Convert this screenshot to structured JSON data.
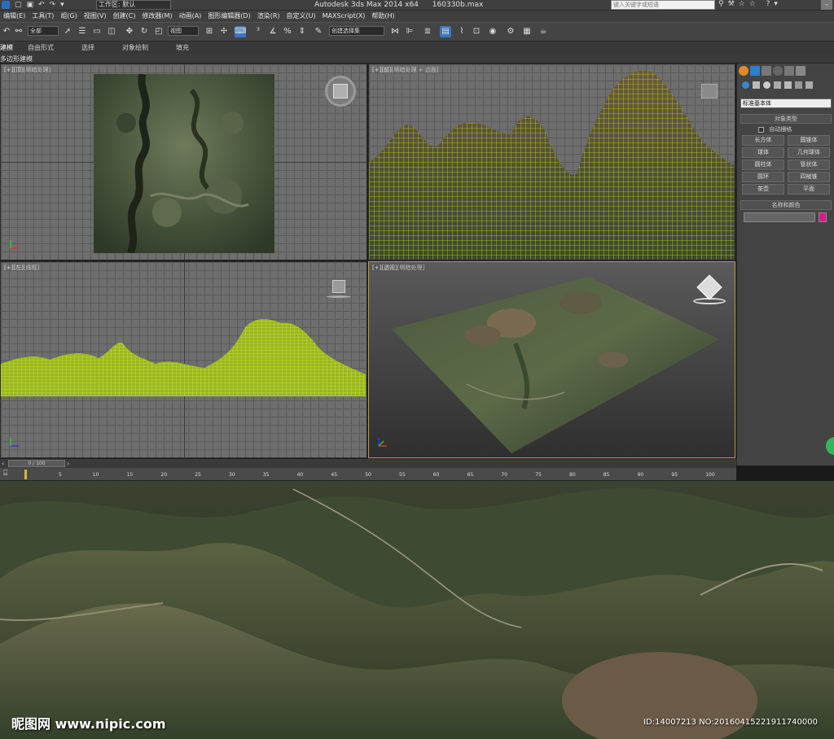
{
  "title": {
    "workspace_label": "工作区: 默认",
    "app_title": "Autodesk 3ds Max  2014 x64",
    "file_name": "160330b.max",
    "search_placeholder": "键入关键字或短语"
  },
  "menu": [
    "编辑(E)",
    "工具(T)",
    "组(G)",
    "视图(V)",
    "创建(C)",
    "修改器(M)",
    "动画(A)",
    "图形编辑器(D)",
    "渲染(R)",
    "自定义(U)",
    "MAXScript(X)",
    "帮助(H)"
  ],
  "toolbar": {
    "selection_filter": "全部",
    "ref_coord": "视图",
    "named_selection": "创建选择集"
  },
  "ribbon": {
    "tabs": [
      "建模",
      "自由形式",
      "选择",
      "对象绘制",
      "填充"
    ],
    "sub_label": "多边形建模"
  },
  "viewports": {
    "top": {
      "label_prefix": "[+]",
      "view": "[顶]",
      "shading": "[明暗处理]"
    },
    "front": {
      "label_prefix": "[+]",
      "view": "[前]",
      "shading": "[明暗处理 + 边面]"
    },
    "left": {
      "label_prefix": "[+]",
      "view": "[左]",
      "shading": "[线框]"
    },
    "perspective": {
      "label_prefix": "[+]",
      "view": "[透视]",
      "shading": "[明暗处理]"
    }
  },
  "command_panel": {
    "dropdown": "标准基本体",
    "object_type_header": "对象类型",
    "autogrid": "自动栅格",
    "buttons": [
      "长方体",
      "圆锥体",
      "球体",
      "几何球体",
      "圆柱体",
      "管状体",
      "圆环",
      "四棱锥",
      "茶壶",
      "平面"
    ],
    "name_color_header": "名称和颜色",
    "color_swatch": "#d81b8a"
  },
  "timeline": {
    "frame_display": "0 / 100",
    "ticks": [
      "5",
      "10",
      "15",
      "20",
      "25",
      "30",
      "35",
      "40",
      "45",
      "50",
      "55",
      "60",
      "65",
      "70",
      "75",
      "80",
      "85",
      "90",
      "95",
      "100"
    ]
  },
  "watermark": {
    "brand": "昵图网 www.nipic.com",
    "id_line": "ID:14007213 NO:20160415221911740000"
  },
  "colors": {
    "wireframe": "#b8d62a",
    "active_viewport_border": "#b8a040"
  }
}
